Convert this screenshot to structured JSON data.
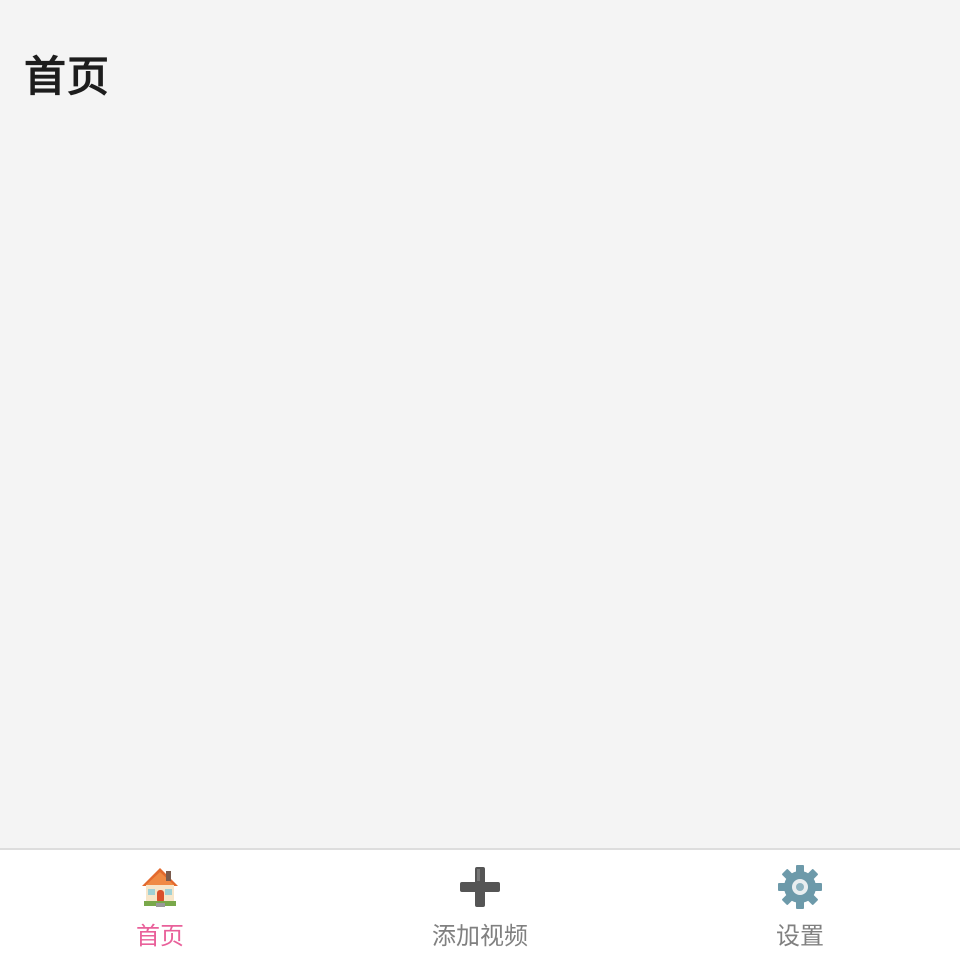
{
  "header": {
    "title": "首页"
  },
  "tab_bar": {
    "active_color": "#e9609a",
    "inactive_color": "#808080",
    "items": [
      {
        "label": "首页",
        "icon": "house-icon",
        "active": true
      },
      {
        "label": "添加视频",
        "icon": "plus-icon",
        "active": false
      },
      {
        "label": "设置",
        "icon": "gear-icon",
        "active": false
      }
    ]
  }
}
